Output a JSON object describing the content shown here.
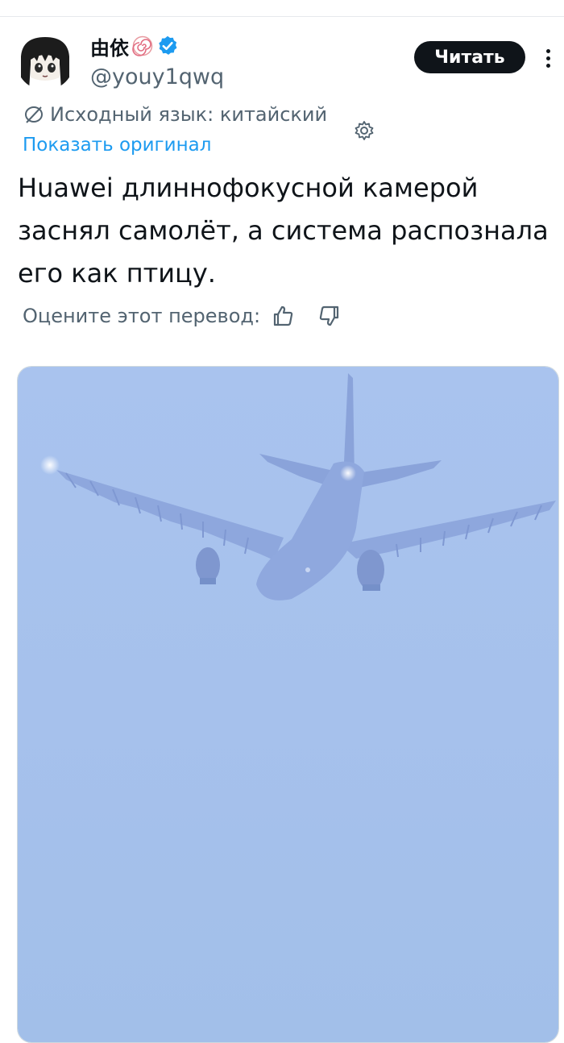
{
  "tweet": {
    "author": {
      "display_name": "由依",
      "handle": "@youy1qwq",
      "verified": true,
      "emoji_icon": "naruto-swirl-icon",
      "avatar_icon": "anime-avatar"
    },
    "follow_label": "Читать",
    "translation": {
      "source_label": "Исходный язык: китайский",
      "show_original": "Показать оригинал",
      "text": "Huawei длиннофокусной камерой заснял самолёт, а система распознала его как птицу.",
      "rate_label": "Оцените этот перевод:"
    },
    "media": {
      "description_icon": "airplane-with-feathered-wings"
    }
  },
  "colors": {
    "text": "#0f1419",
    "muted": "#536471",
    "link": "#1d9bf0",
    "verified": "#1d9bf0",
    "button_bg": "#0f1419",
    "sky": "#a7c3ec"
  }
}
